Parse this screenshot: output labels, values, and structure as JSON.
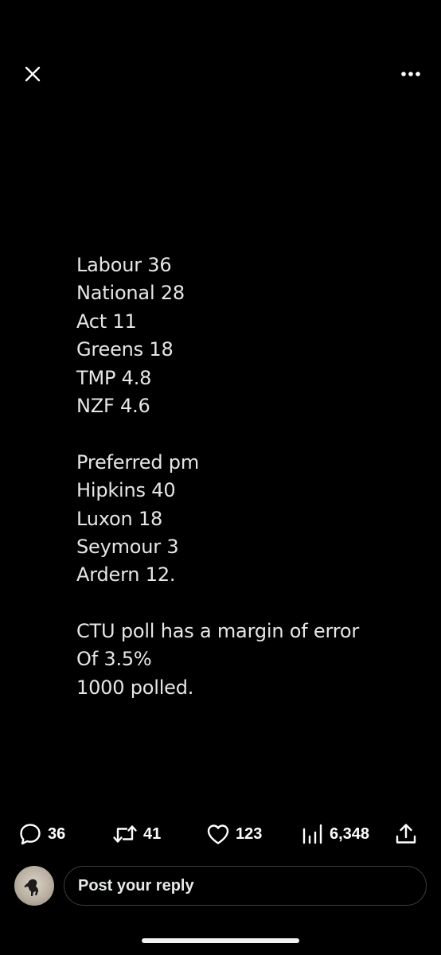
{
  "header": {
    "close_icon": "close-icon",
    "more_icon": "more-horizontal-icon"
  },
  "media": {
    "lines": [
      "Labour 36",
      "National 28",
      "Act 11",
      "Greens 18",
      "TMP 4.8",
      "NZF 4.6",
      "",
      "Preferred pm",
      "Hipkins 40",
      "Luxon 18",
      "Seymour 3",
      "Ardern 12.",
      "",
      "CTU poll has a margin of error",
      "Of 3.5%",
      "1000 polled."
    ]
  },
  "actions": {
    "replies": "36",
    "reposts": "41",
    "likes": "123",
    "views": "6,348"
  },
  "reply": {
    "placeholder": "Post your reply"
  },
  "colors": {
    "background": "#000000",
    "text": "#e6e6e6",
    "input_border": "#3a3d40"
  }
}
